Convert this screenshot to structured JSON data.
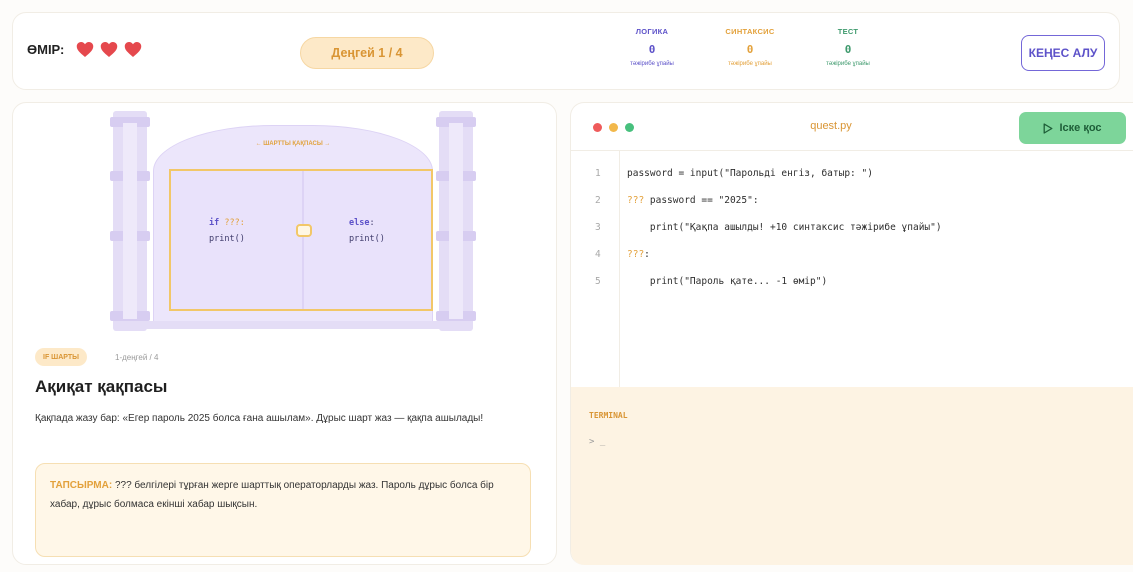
{
  "header": {
    "lives_label": "ӨМІР:",
    "lives_count": 3,
    "level_label": "Деңгей 1 / 4",
    "scores": [
      {
        "name": "ЛОГИКА",
        "value": "0",
        "sub": "тәжірибе ұпайы",
        "color": "#5d52c9"
      },
      {
        "name": "СИНТАКСИС",
        "value": "0",
        "sub": "тәжірибе ұпайы",
        "color": "#e3a13b"
      },
      {
        "name": "ТЕСТ",
        "value": "0",
        "sub": "тәжірибе ұпайы",
        "color": "#3e9a6d"
      }
    ],
    "hint_button": "КЕҢЕС АЛУ",
    "heart_color": "#e5484d"
  },
  "scene": {
    "gate_sign": "← ШАРТТЫ ҚАҚПАСЫ →",
    "door_left_kw": "if",
    "door_left_q": "???:",
    "door_left_print": "print()",
    "door_right_kw": "else",
    "door_right_colon": ":",
    "door_right_print": "print()"
  },
  "quest": {
    "badge": "IF ШАРТЫ",
    "level_small": "1-деңгей / 4",
    "title": "Ақиқат қақпасы",
    "description": "Қақпада жазу бар: «Егер пароль 2025 болса ғана ашылам». Дұрыс шарт жаз — қақпа ашылады!",
    "task_label": "ТАПСЫРМА:",
    "task_text": " ??? белгілері тұрған жерге шарттық операторларды жаз. Пароль дұрыс болса бір хабар, дұрыс болмаса екінші хабар шықсын."
  },
  "editor": {
    "filename": "quest.py",
    "run_button": "Іске қос",
    "lines": [
      {
        "n": "1",
        "pre": "password = input(\"Парольді енгіз, батыр: \")",
        "q": "",
        "post": ""
      },
      {
        "n": "2",
        "pre": "",
        "q": "???",
        "post": " password == \"2025\":"
      },
      {
        "n": "3",
        "pre": "    print(\"Қақпа ашылды! +10 синтаксис тәжірибе ұпайы\")",
        "q": "",
        "post": ""
      },
      {
        "n": "4",
        "pre": "",
        "q": "???",
        "post": ":"
      },
      {
        "n": "5",
        "pre": "    print(\"Пароль қате... -1 өмір\")",
        "q": "",
        "post": ""
      }
    ]
  },
  "terminal": {
    "label": "TERMINAL",
    "prompt": "> _"
  }
}
